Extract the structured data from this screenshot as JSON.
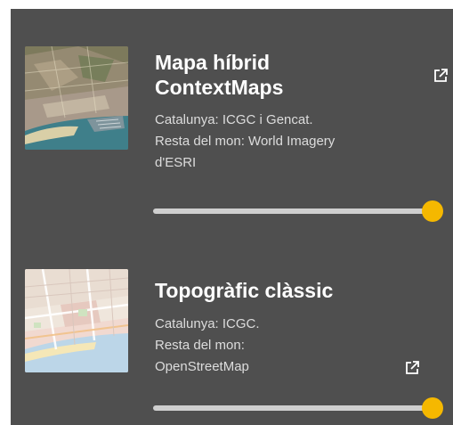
{
  "layers": [
    {
      "title_line1": "Mapa híbrid",
      "title_line2": "ContextMaps",
      "desc_line1": "Catalunya: ICGC i Gencat.",
      "desc_line2": "Resta del mon: World Imagery",
      "desc_line3": "d'ESRI",
      "thumbnail_icon": "satellite-hybrid-map-thumbnail",
      "external_link_icon": "external-link-icon",
      "opacity_percent": 100
    },
    {
      "title_line1": "Topogràfic clàssic",
      "desc_line1": "Catalunya: ICGC.",
      "desc_line2": "Resta del mon:",
      "desc_line3": "OpenStreetMap",
      "thumbnail_icon": "topographic-map-thumbnail",
      "external_link_icon": "external-link-icon",
      "opacity_percent": 100
    }
  ],
  "colors": {
    "panel_background": "#4f4f4f",
    "slider_track": "#cfcfcf",
    "slider_knob": "#f5b800",
    "title_text": "#ffffff",
    "desc_text": "#dcdcdc"
  }
}
